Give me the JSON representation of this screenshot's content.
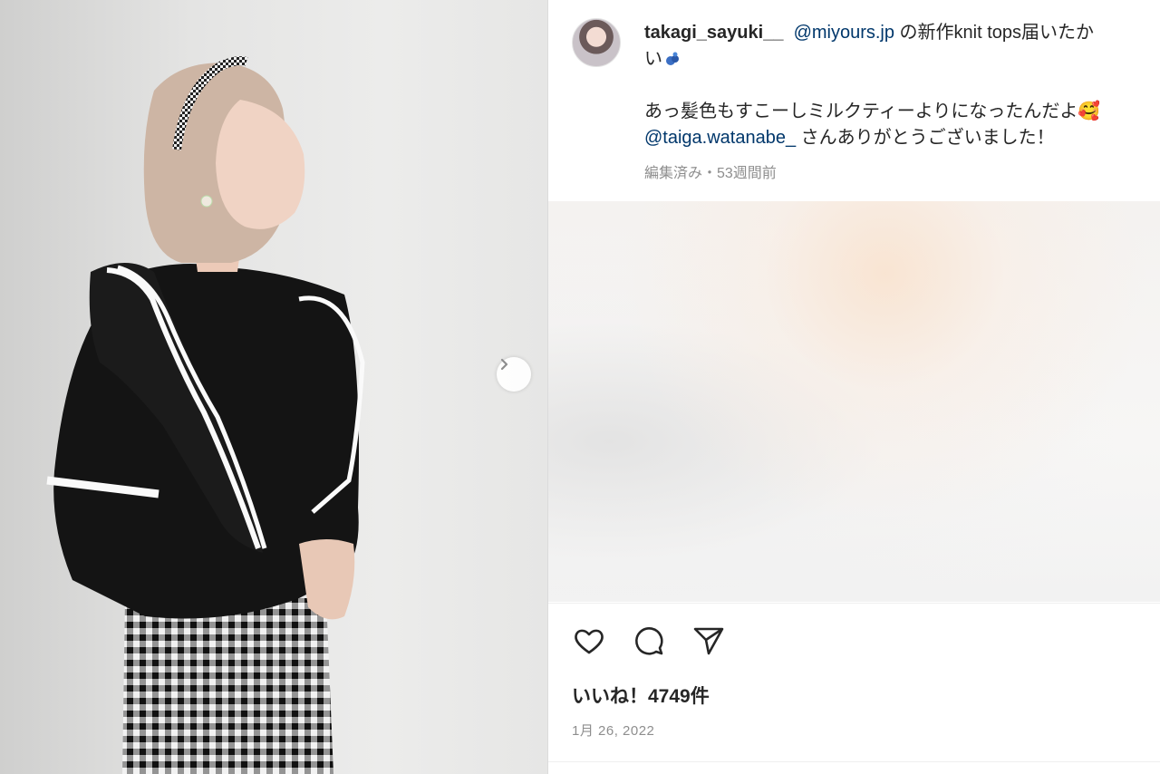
{
  "post": {
    "username": "takagi_sayuki__",
    "caption_line1_mention": "@miyours.jp",
    "caption_line1_text": " の新作knit tops届いたか",
    "caption_line2": "い",
    "caption_line3": "あっ髪色もすこーしミルクティーよりになったんだよ🥰",
    "caption_line4_mention": "@taiga.watanabe_",
    "caption_line4_text": " さんありがとうございました！",
    "edited_meta": "編集済み・53週間前",
    "likes": "いいね！4749件",
    "date": "1月 26, 2022"
  },
  "icons": {
    "next": "chevron-right-icon",
    "like": "heart-icon",
    "comment": "comment-bubble-icon",
    "share": "paper-plane-icon"
  },
  "colors": {
    "mention": "#00376b",
    "meta": "#8e8e8e",
    "text": "#262626"
  }
}
